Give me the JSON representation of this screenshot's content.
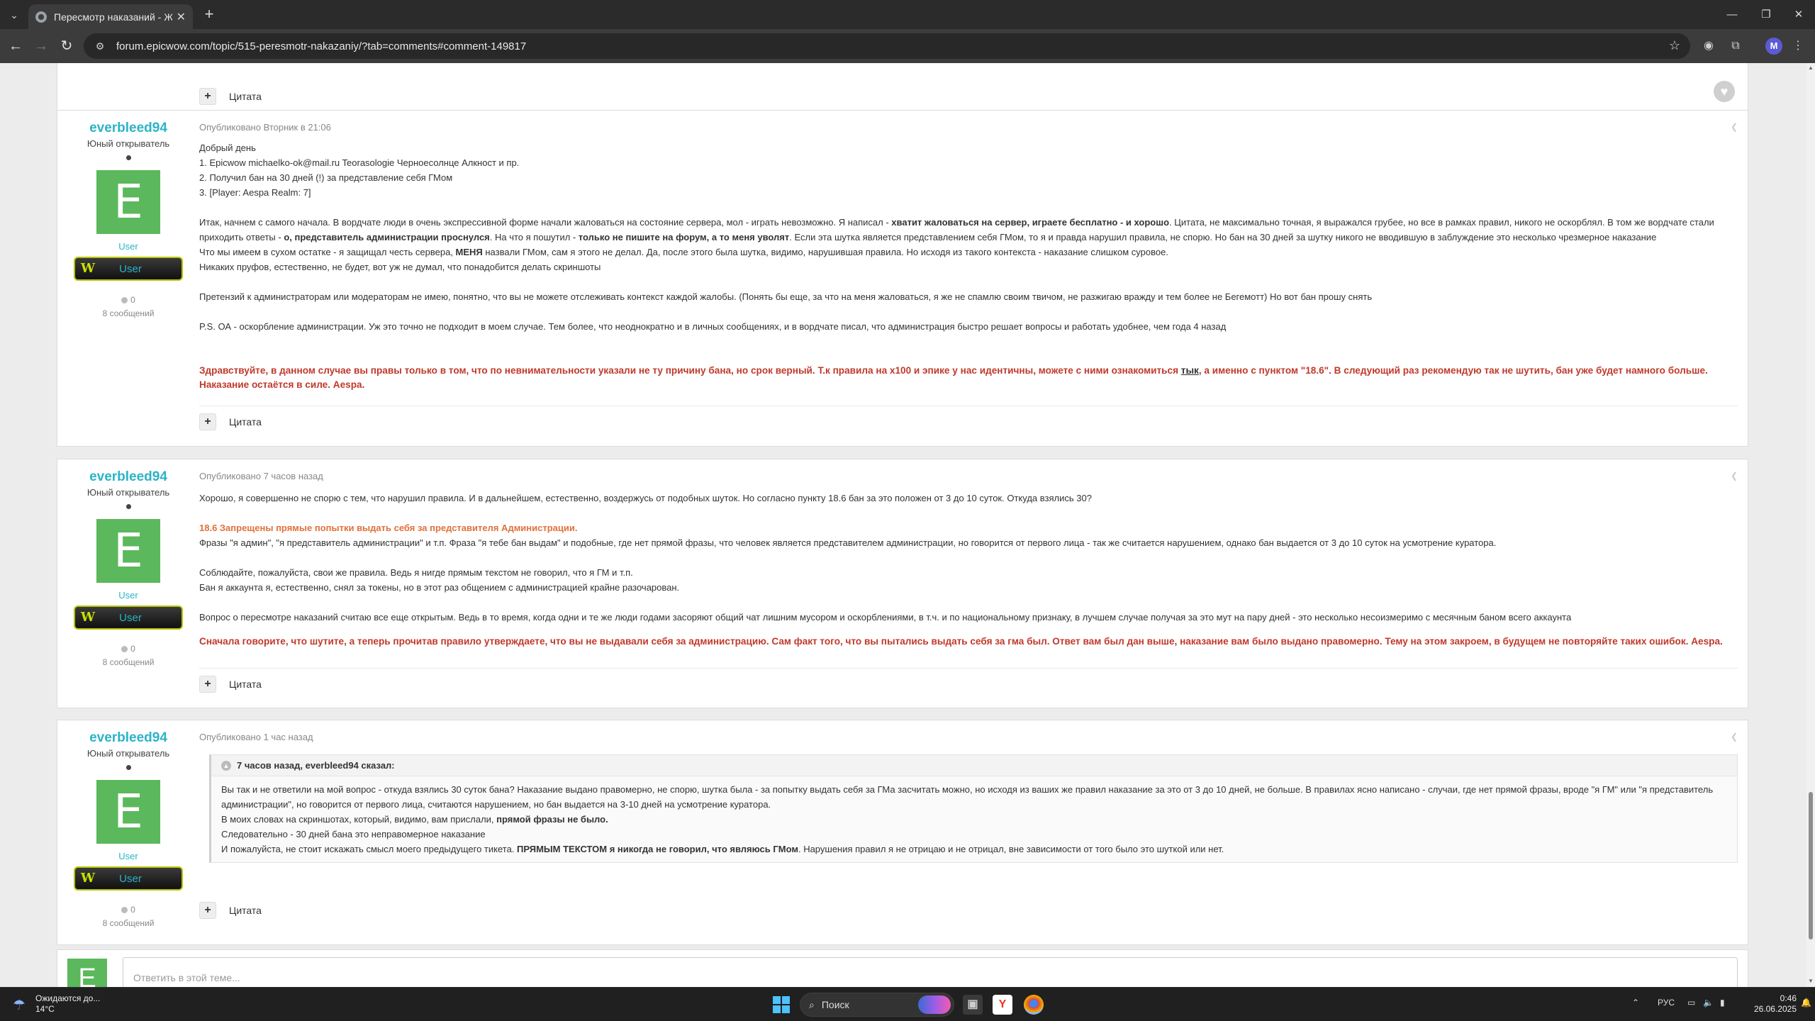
{
  "browser": {
    "tab_title": "Пересмотр наказаний - Жалобы",
    "url": "forum.epicwow.com/topic/515-peresmotr-nakazaniy/?tab=comments#comment-149817",
    "profile_initial": "M"
  },
  "top_fragment": {
    "quote_label": "Цитата"
  },
  "posts": [
    {
      "author": "everbleed94",
      "rank": "Юный открыватель",
      "avatar_letter": "E",
      "group": "User",
      "badge": "User",
      "rep": "0",
      "post_count": "8 сообщений",
      "meta": "Опубликовано Вторник в 21:06",
      "lines": [
        "Добрый день",
        "1. Epicwow  michaelko-ok@mail.ru   Teorasologie Черноесолнце Алкност и пр.",
        "2. Получил бан на 30 дней (!) за представление себя ГМом",
        "3. [Player: Aespa Realm: 7]"
      ],
      "p2_a": "Итак, начнем с самого начала. В вордчате люди в очень экспрессивной форме начали жаловаться на состояние сервера, мол - играть невозможно. Я написал - ",
      "p2_b": "хватит жаловаться на сервер, играете бесплатно - и хорошо",
      "p2_c": ". Цитата, не максимально точная, я выражался грубее, но все в рамках правил, никого не оскорблял. В том же вордчате стали приходить ответы - ",
      "p2_d": "о, представитель администрации проснулся",
      "p2_e": ". На что я пошутил - ",
      "p2_f": "только не пишите на форум, а то меня уволят",
      "p2_g": ". Если эта шутка является представлением себя ГМом, то я и правда нарушил правила, не спорю. Но бан на 30 дней за шутку никого не вводившую в заблуждение это несколько чрезмерное наказание",
      "p3_a": "Что мы имеем в сухом остатке - я защищал честь сервера, ",
      "p3_b": "МЕНЯ",
      "p3_c": " назвали ГМом, сам я этого не делал. Да, после этого была шутка, видимо, нарушившая правила. Но исходя из такого контекста - наказание слишком суровое.",
      "p4": "Никаких пруфов, естественно, не будет, вот уж не думал, что понадобится делать скриншоты",
      "p5": "Претензий к администраторам или модераторам не имею, понятно, что вы не можете отслеживать контекст каждой жалобы. (Понять бы еще, за что на меня жаловаться, я же не спамлю своим твичом, не разжигаю вражду и тем более не Бегемотт) Но вот бан прошу снять",
      "p6": "P.S. ОА - оскорбление администрации. Уж это точно не подходит в моем случае. Тем более, что неоднократно и в личных сообщениях, и в вордчате писал, что администрация быстро решает вопросы и работать удобнее, чем года 4 назад",
      "mod_a": "Здравствуйте, в данном случае вы правы только в том, что по невнимательности указали не ту причину бана, но срок верный. Т.к правила на x100 и эпике у нас идентичны, можете с ними ознакомиться ",
      "mod_link": "тык",
      "mod_b": ", а именно с пунктом \"18.6\". В следующий раз рекомендую так не шутить, бан уже будет намного больше. Наказание остаётся в силе. Aespa.",
      "quote_label": "Цитата"
    },
    {
      "author": "everbleed94",
      "rank": "Юный открыватель",
      "avatar_letter": "E",
      "group": "User",
      "badge": "User",
      "rep": "0",
      "post_count": "8 сообщений",
      "meta": "Опубликовано 7 часов назад",
      "l1": "Хорошо, я совершенно не спорю с тем, что нарушил правила. И в дальнейшем, естественно, воздержусь от подобных шуток. Но согласно пункту 18.6 бан за это положен от 3 до 10 суток. Откуда взялись 30?",
      "rule_head": "18.6 Запрещены прямые попытки выдать себя за представителя Администрации.",
      "rule_body": "Фразы \"я админ\", \"я представитель администрации\" и т.п. Фраза \"я тебе бан выдам\" и подобные, где нет прямой фразы, что человек является представителем администрации, но говорится от первого лица - так же считается нарушением, однако бан выдается от 3 до 10 суток на усмотрение куратора.",
      "l3": "Соблюдайте, пожалуйста, свои же правила. Ведь я нигде прямым текстом не говорил, что я ГМ и т.п.",
      "l4": "Бан я аккаунта я, естественно, снял за токены, но в этот раз общением с администрацией крайне разочарован.",
      "l5": "Вопрос о пересмотре наказаний считаю все еще открытым. Ведь в то время, когда одни и те же люди годами засоряют общий чат лишним мусором и оскорблениями, в т.ч. и по национальному признаку, в лучшем случае получая за это мут на пару дней - это несколько несоизмеримо с месячным баном всего аккаунта",
      "mod": " Сначала говорите, что шутите, а теперь прочитав правило утверждаете, что вы не выдавали себя за администрацию. Сам факт того, что вы пытались выдать себя за гма был. Ответ вам был дан выше, наказание вам было выдано правомерно. Тему на этом закроем, в будущем не повторяйте таких ошибок. Aespa.",
      "quote_label": "Цитата"
    },
    {
      "author": "everbleed94",
      "rank": "Юный открыватель",
      "avatar_letter": "E",
      "group": "User",
      "badge": "User",
      "rep": "0",
      "post_count": "8 сообщений",
      "meta": "Опубликовано 1 час назад",
      "bq_head": "7 часов назад, everbleed94 сказал:",
      "bq_l1": "Вы так и не ответили на мой вопрос - откуда взялись 30 суток бана? Наказание выдано правомерно, не спорю, шутка была - за попытку выдать себя за ГМа засчитать можно, но исходя из ваших же правил наказание за это от 3 до 10 дней, не больше. В правилах ясно написано - случаи, где нет прямой фразы, вроде \"я ГМ\" или \"я представитель администрации\", но говорится от первого лица, считаются нарушением, но бан выдается на 3-10 дней на усмотрение куратора.",
      "bq_l2_a": "В моих словах на скриншотах, который, видимо, вам прислали, ",
      "bq_l2_b": "прямой фразы не было.",
      "bq_l3": "Следовательно - 30 дней бана это неправомерное наказание",
      "bq_l4_a": "И пожалуйста, не стоит искажать смысл моего предыдущего тикета. ",
      "bq_l4_b": "ПРЯМЫМ ТЕКСТОМ я никогда не говорил, что являюсь ГМом",
      "bq_l4_c": ". Нарушения правил я не отрицаю и не отрицал, вне зависимости от того было это шуткой или нет.",
      "quote_label": "Цитата"
    }
  ],
  "reply": {
    "avatar_letter": "E",
    "placeholder": "Ответить в этой теме..."
  },
  "taskbar": {
    "weather_line1": "Ожидаются до...",
    "weather_line2": "14°C",
    "search": "Поиск",
    "lang": "РУС",
    "time": "0:46",
    "date": "26.06.2025"
  }
}
